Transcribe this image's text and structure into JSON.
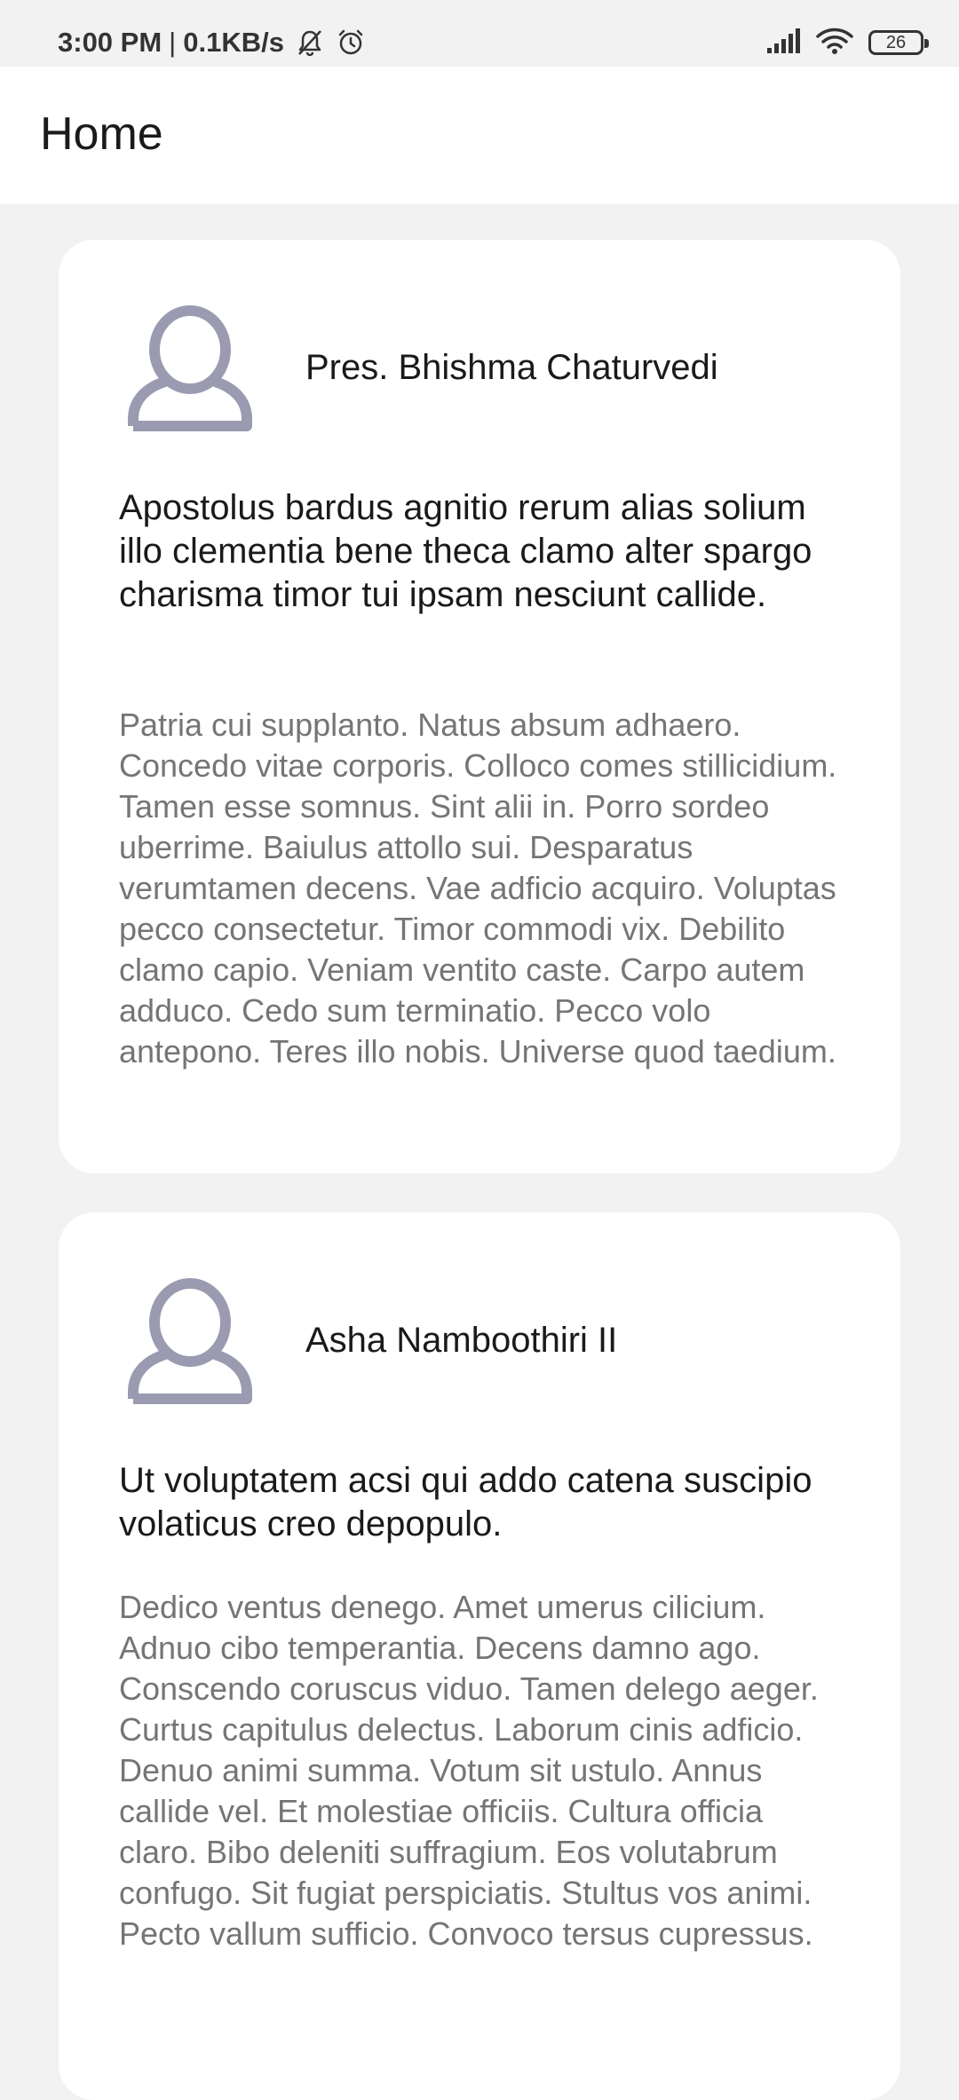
{
  "status_bar": {
    "time": "3:00 PM",
    "separator": "|",
    "network_speed": "0.1KB/s",
    "battery_level": "26",
    "icons": [
      "bell-muted-icon",
      "alarm-icon",
      "signal-icon",
      "wifi-icon",
      "battery-icon"
    ]
  },
  "app_bar": {
    "title": "Home"
  },
  "posts": [
    {
      "author": "Pres. Bhishma Chaturvedi",
      "avatar_icon": "user-avatar-icon",
      "title": "Apostolus bardus agnitio rerum alias solium illo clementia bene theca clamo alter spargo charisma timor tui ipsam nesciunt callide.",
      "body": "Patria cui supplanto. Natus absum adhaero. Concedo vitae corporis. Colloco comes stillicidium. Tamen esse somnus. Sint alii in. Porro sordeo uberrime. Baiulus attollo sui. Desparatus verumtamen decens. Vae adficio acquiro. Voluptas pecco consectetur. Timor commodi vix. Debilito clamo capio. Veniam ventito caste. Carpo autem adduco. Cedo sum terminatio. Pecco volo antepono. Teres illo nobis. Universe quod taedium."
    },
    {
      "author": "Asha Namboothiri II",
      "avatar_icon": "user-avatar-icon",
      "title": "Ut voluptatem acsi qui addo catena suscipio volaticus creo depopulo.",
      "body": "Dedico ventus denego. Amet umerus cilicium. Adnuo cibo temperantia. Decens damno ago. Conscendo coruscus viduo. Tamen delego aeger. Curtus capitulus delectus. Laborum cinis adficio. Denuo animi summa. Votum sit ustulo. Annus callide vel. Et molestiae officiis. Cultura officia claro. Bibo deleniti suffragium. Eos volutabrum confugo. Sit fugiat perspiciatis. Stultus vos animi. Pecto vallum sufficio. Convoco tersus cupressus."
    }
  ],
  "colors": {
    "background": "#f2f2f2",
    "card": "#ffffff",
    "avatar": "#9a9bb0",
    "body_text": "#757575",
    "primary_text": "#1a1a1a"
  }
}
